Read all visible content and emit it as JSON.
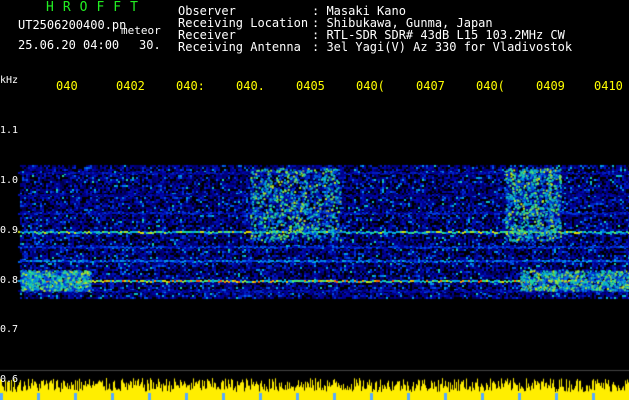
{
  "header": {
    "brand": "HROFFT",
    "filename": "UT2506200400.pn",
    "tag": "meteor",
    "datetime": "25.06.20 04:00",
    "interval": "30.",
    "info": [
      {
        "label": "Observer",
        "value": ": Masaki Kano"
      },
      {
        "label": "Receiving Location",
        "value": ": Shibukawa, Gunma, Japan"
      },
      {
        "label": "Receiver",
        "value": ": RTL-SDR SDR# 43dB L15 103.2MHz CW"
      },
      {
        "label": "Receiving Antenna",
        "value": ": 3el Yagi(V) Az 330 for Vladivostok"
      }
    ]
  },
  "plot": {
    "y_unit": "kHz",
    "x_ticks": [
      "040",
      "0402",
      "040:",
      "040.",
      "0405",
      "040(",
      "0407",
      "040(",
      "0409",
      "0410"
    ],
    "y_ticks": [
      "1.1",
      "1.0",
      "0.9",
      "0.8",
      "0.7",
      "0.6"
    ],
    "colors": {
      "tick": "#ffff00",
      "trace": "#ffee00",
      "brand": "#22ee22"
    }
  }
}
